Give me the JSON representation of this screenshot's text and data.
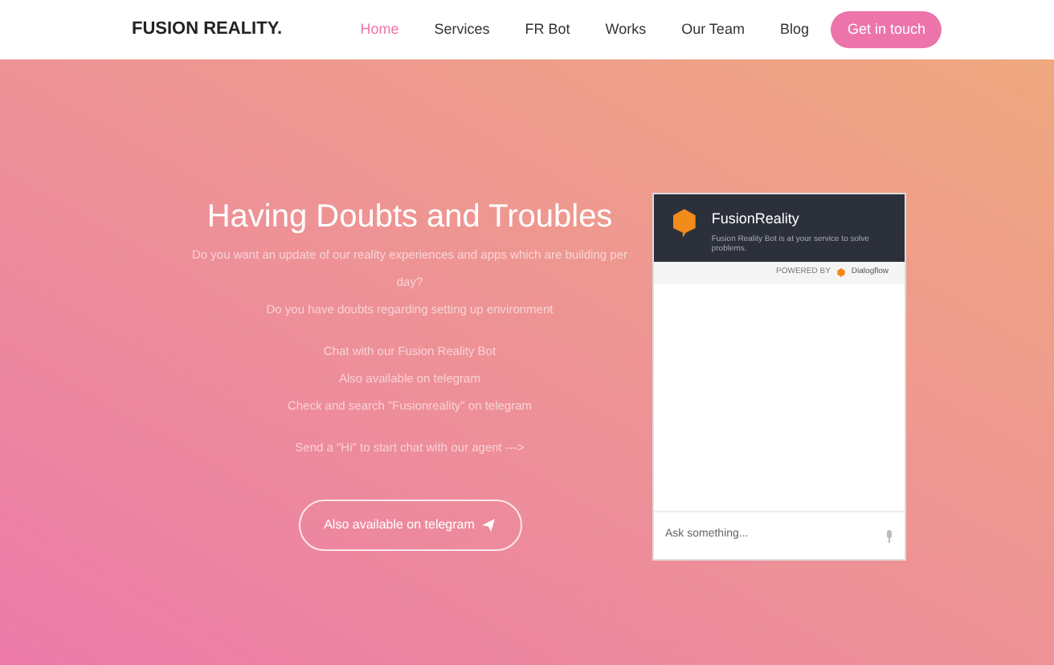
{
  "header": {
    "logo": "FUSION REALITY.",
    "nav": [
      {
        "label": "Home",
        "selected": true
      },
      {
        "label": "Services",
        "selected": false
      },
      {
        "label": "FR Bot",
        "selected": false
      },
      {
        "label": "Works",
        "selected": false
      },
      {
        "label": "Our Team",
        "selected": false
      },
      {
        "label": "Blog",
        "selected": false
      }
    ],
    "cta": "Get in touch"
  },
  "hero": {
    "title": "Having Doubts and Troubles",
    "paragraphs": [
      [
        "Do you want an update of our reality experiences and apps which are building per day?",
        "Do you have doubts regarding setting up environment"
      ],
      [
        "Chat with our Fusion Reality Bot",
        "Also available on telegram",
        "Check and search \"Fusionreality\" on telegram"
      ],
      [
        "Send a \"Hi\" to start chat with our agent --->"
      ]
    ],
    "button": "Also available on telegram"
  },
  "chat": {
    "title": "FusionReality",
    "subtitle": "Fusion Reality Bot is at your service to solve problems.",
    "powered_by": "POWERED BY",
    "brand": "Dialogflow",
    "placeholder": "Ask something..."
  }
}
